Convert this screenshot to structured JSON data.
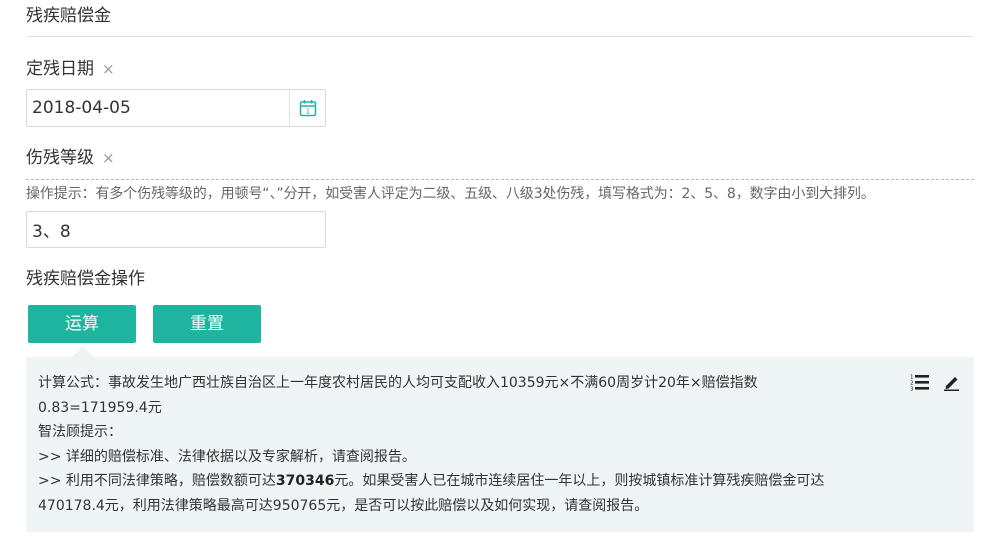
{
  "section": {
    "title": "残疾赔偿金"
  },
  "fields": {
    "date": {
      "label": "定残日期",
      "clear": "×",
      "value": "2018-04-05"
    },
    "level": {
      "label": "伤残等级",
      "clear": "×",
      "hint": "操作提示：有多个伤残等级的，用顿号“、”分开，如受害人评定为二级、五级、八级3处伤残，填写格式为：2、5、8，数字由小到大排列。",
      "value": "3、8"
    }
  },
  "actions": {
    "label": "残疾赔偿金操作",
    "calculate": "运算",
    "reset": "重置"
  },
  "result": {
    "formula_1": "计算公式：事故发生地广西壮族自治区上一年度农村居民的人均可支配收入10359元×不满60周岁计20年×赔偿指数",
    "formula_2": "0.83=171959.4元",
    "tip_title": "智法顾提示：",
    "tip_1": ">> 详细的赔偿标准、法律依据以及专家解析，请查阅报告。",
    "tip_2_pre": ">> 利用不同法律策略，赔偿数额可达",
    "tip_2_bold": "370346",
    "tip_2_post": "元。如果受害人已在城市连续居住一年以上，则按城镇标准计算残疾赔偿金可达",
    "tip_3": "470178.4元，利用法律策略最高可达950765元，是否可以按此赔偿以及如何实现，请查阅报告。"
  },
  "colors": {
    "accent": "#1fb4a0",
    "panel_bg": "#eef5f4"
  },
  "icons": {
    "calendar": "calendar-icon",
    "list": "numbered-list-icon",
    "edit": "pencil-icon"
  }
}
